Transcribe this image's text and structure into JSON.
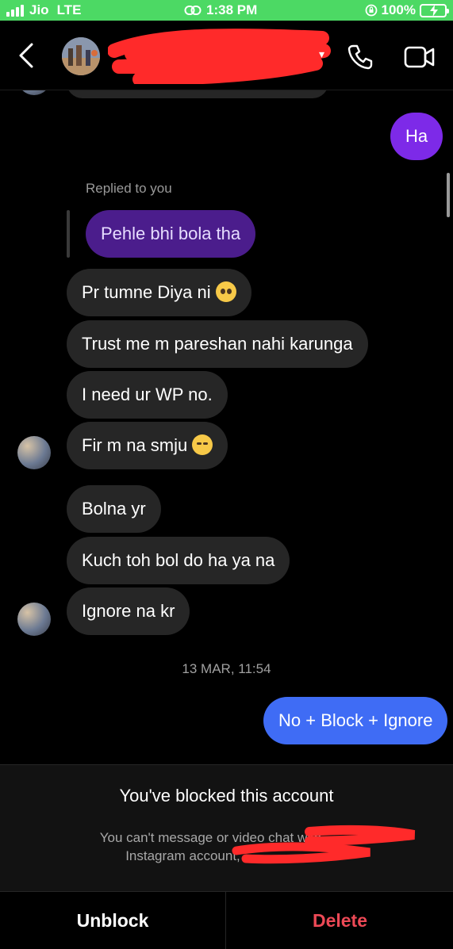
{
  "status_bar": {
    "carrier": "Jio",
    "network": "LTE",
    "time": "1:38 PM",
    "battery": "100%",
    "background_color": "#4cd964"
  },
  "header": {
    "icons": {
      "back": "chevron-left-icon",
      "call": "phone-icon",
      "video": "video-camera-icon"
    }
  },
  "messages": {
    "sent_ha": "Ha",
    "replied_label": "Replied to you",
    "quoted_reply": "Pehle bhi bola tha",
    "received": [
      {
        "text": "Pr tumne Diya ni",
        "emoji": "pleading-face"
      },
      {
        "text": "Trust me m pareshan nahi karunga",
        "emoji": ""
      },
      {
        "text": "I need ur WP no.",
        "emoji": ""
      },
      {
        "text": "Fir m na smju",
        "emoji": "pensive-face"
      },
      {
        "text": "Bolna yr",
        "emoji": ""
      },
      {
        "text": "Kuch toh bol do ha ya na",
        "emoji": ""
      },
      {
        "text": "Ignore na kr",
        "emoji": ""
      }
    ],
    "timestamp": "13 MAR, 11:54",
    "sent_last": "No + Block + Ignore"
  },
  "blocked": {
    "title": "You've blocked this account",
    "desc_line1": "You can't message or video chat with",
    "desc_line2": "Instagram account,"
  },
  "actions": {
    "unblock": "Unblock",
    "delete": "Delete",
    "delete_color": "#ed4956"
  },
  "colors": {
    "sent_purple": "#7d2ae8",
    "sent_blue": "#3f6cf5",
    "received_bubble": "#262626",
    "redaction": "#ff2a2a"
  }
}
